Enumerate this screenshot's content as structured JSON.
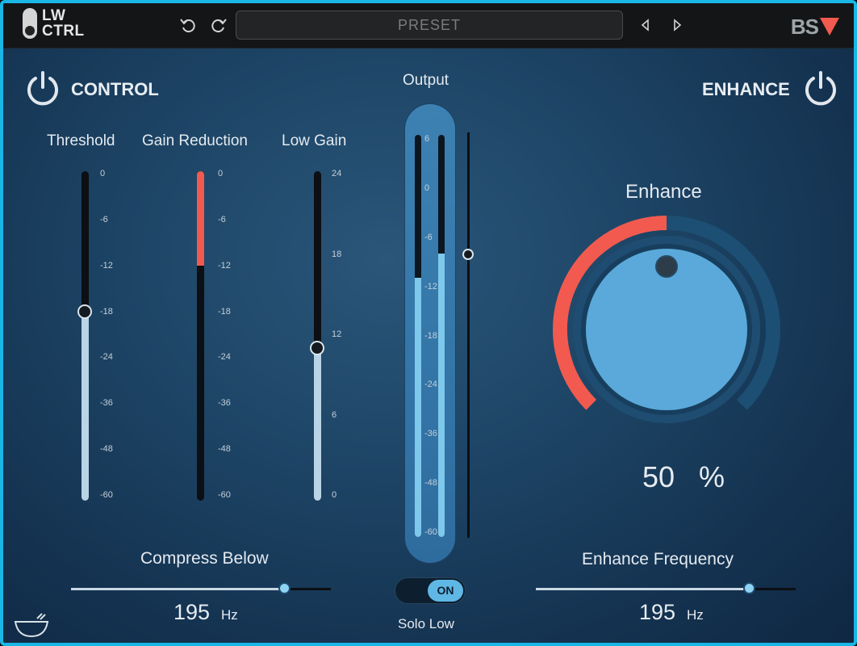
{
  "app": {
    "logo_line1": "LW",
    "logo_line2": "CTRL",
    "brand": "BS"
  },
  "toolbar": {
    "preset_label": "PRESET"
  },
  "control": {
    "title": "CONTROL",
    "threshold": {
      "label": "Threshold",
      "value_db": -18,
      "scale": [
        "0",
        "-6",
        "-12",
        "-18",
        "-24",
        "-36",
        "-48",
        "-60"
      ]
    },
    "gain_reduction": {
      "label": "Gain Reduction",
      "value_db": -12,
      "scale": [
        "0",
        "-6",
        "-12",
        "-18",
        "-24",
        "-36",
        "-48",
        "-60"
      ]
    },
    "low_gain": {
      "label": "Low Gain",
      "value_db": 11,
      "scale": [
        "24",
        "18",
        "12",
        "6",
        "0"
      ]
    },
    "compress_below": {
      "label": "Compress Below",
      "value": "195",
      "unit": "Hz",
      "position": 0.82
    }
  },
  "output": {
    "label": "Output",
    "scale": [
      "6",
      "0",
      "-6",
      "-12",
      "-18",
      "-24",
      "-36",
      "-48",
      "-60"
    ],
    "meter_left_fill": 0.64,
    "meter_right_fill": 0.7,
    "fader_position": 0.7,
    "solo_low": {
      "label": "Solo Low",
      "state": "ON"
    }
  },
  "enhance": {
    "title": "ENHANCE",
    "knob_label": "Enhance",
    "value": "50",
    "unit": "%",
    "amount": 0.5,
    "frequency": {
      "label": "Enhance Frequency",
      "value": "195",
      "unit": "Hz",
      "position": 0.82
    }
  },
  "colors": {
    "accent_red": "#f25a4f",
    "accent_blue": "#7ec8ec",
    "border": "#19b7e6"
  },
  "icons": [
    "power-icon",
    "undo-icon",
    "redo-icon",
    "prev-arrow-icon",
    "next-arrow-icon",
    "bowl-icon"
  ]
}
